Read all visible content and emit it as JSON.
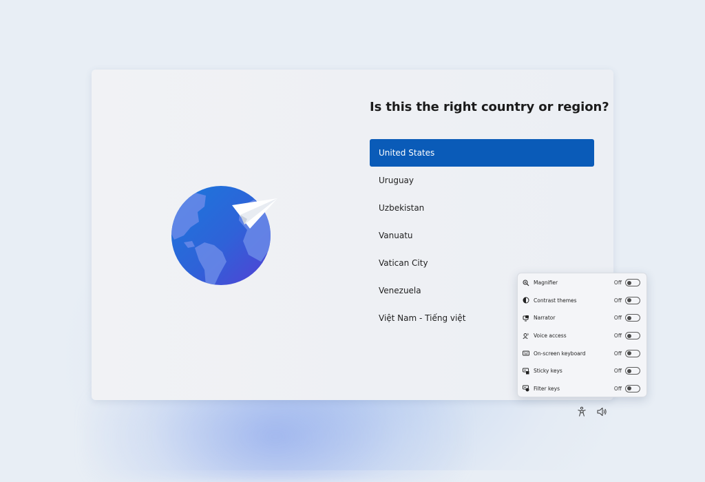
{
  "page": {
    "title": "Is this the right country or region?"
  },
  "countries": [
    {
      "label": "United States",
      "selected": true
    },
    {
      "label": "Uruguay",
      "selected": false
    },
    {
      "label": "Uzbekistan",
      "selected": false
    },
    {
      "label": "Vanuatu",
      "selected": false
    },
    {
      "label": "Vatican City",
      "selected": false
    },
    {
      "label": "Venezuela",
      "selected": false
    },
    {
      "label": "Việt Nam - Tiếng việt",
      "selected": false
    }
  ],
  "accessibility_panel": {
    "items": [
      {
        "label": "Magnifier",
        "state": "Off",
        "icon": "magnifier-icon"
      },
      {
        "label": "Contrast themes",
        "state": "Off",
        "icon": "contrast-icon"
      },
      {
        "label": "Narrator",
        "state": "Off",
        "icon": "narrator-icon"
      },
      {
        "label": "Voice access",
        "state": "Off",
        "icon": "voice-access-icon"
      },
      {
        "label": "On-screen keyboard",
        "state": "Off",
        "icon": "keyboard-icon"
      },
      {
        "label": "Sticky keys",
        "state": "Off",
        "icon": "sticky-keys-icon"
      },
      {
        "label": "Filter keys",
        "state": "Off",
        "icon": "filter-keys-icon"
      }
    ]
  },
  "bottom_bar": {
    "icons": [
      "accessibility-icon",
      "volume-icon"
    ]
  },
  "colors": {
    "accent": "#0a5bb8",
    "globe_dark": "#1f6fd6",
    "globe_purple": "#4f45d6"
  }
}
